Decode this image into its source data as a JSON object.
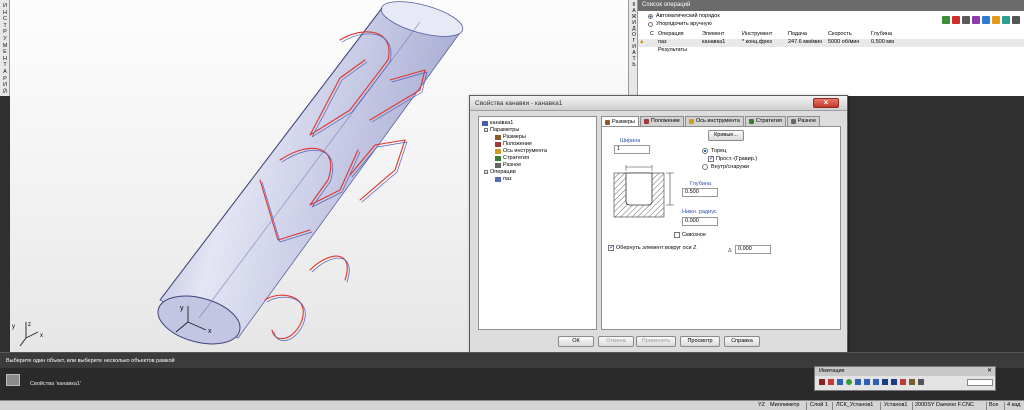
{
  "left_strip": {
    "letters": [
      "И",
      "Н",
      "С",
      "Т",
      "Р",
      "У",
      "М",
      "Е",
      "Н",
      "Т",
      "А",
      "Р",
      "И",
      "Й"
    ]
  },
  "viewport": {
    "axis_labels": {
      "y": "y",
      "x": "x",
      "z": "z"
    },
    "part_color": "#c9cde6",
    "toolpath_color": "#e0342c"
  },
  "right_strip": {
    "letters": [
      "К",
      "А",
      "Ж",
      "И",
      "Д",
      "О",
      "Г",
      "И",
      "А",
      "Т",
      "Ь"
    ]
  },
  "operations": {
    "title": "Список операций",
    "radio_auto": "Автоматический порядок",
    "radio_manual": "Упорядочить вручную",
    "columns": [
      "С",
      "Операция",
      "Элемент",
      "Инструмент",
      "Подача",
      "Скорость",
      "Глубина"
    ],
    "row": {
      "operation": "паз",
      "element": "канавка1",
      "tool": "* конц.фрез",
      "feed": "247.6 мм/мин",
      "speed": "5000 об/мин",
      "depth": "0.500 мм"
    },
    "results": "Результаты"
  },
  "dialog": {
    "title": "Свойства канавки - канавка1",
    "tree": {
      "root": "канавка1",
      "params": "Параметры",
      "dims": "Размеры",
      "position": "Положение",
      "tool_axis": "Ось инструмента",
      "strategy": "Стратегия",
      "misc": "Разное",
      "ops": "Операции",
      "op_item": "паз"
    },
    "tabs": [
      "Размеры",
      "Положение",
      "Ось инструмента",
      "Стратегия",
      "Разное"
    ],
    "width_label": "Ширина",
    "width_value": "1",
    "curves_button": "Кривые...",
    "face_label": "Торец",
    "engrave_label": "Прост.-(Гравир.)",
    "in_out_label": "Внутр/снаружи",
    "depth_label": "Глубина",
    "depth_value": "0.500",
    "radius_label": "Нижн. радиус",
    "radius_value": "0.000",
    "through_label": "Сквозное",
    "wrap_label": "Обернуть элемент вокруг оси Z",
    "wrap_angle_symbol": "Δ",
    "wrap_value": "0.000",
    "buttons": {
      "ok": "ОК",
      "cancel": "Отмена",
      "apply": "Применить",
      "view": "Просмотр",
      "help": "Справка"
    }
  },
  "prompt": "Выберите один объект, или выберите несколько объектов рамкой",
  "command_text": "Свойства 'канавка1'",
  "simulation": {
    "title": "Имитация",
    "close": "✕"
  },
  "status": {
    "plane": "YZ",
    "units": "Миллиметр",
    "layer": "Слой 1",
    "lsk": "ЛСК_Установ1",
    "setup": "Установ1",
    "machine": "2000SY Daewoo F.CNC",
    "all": "Все",
    "count": "4 кад"
  }
}
